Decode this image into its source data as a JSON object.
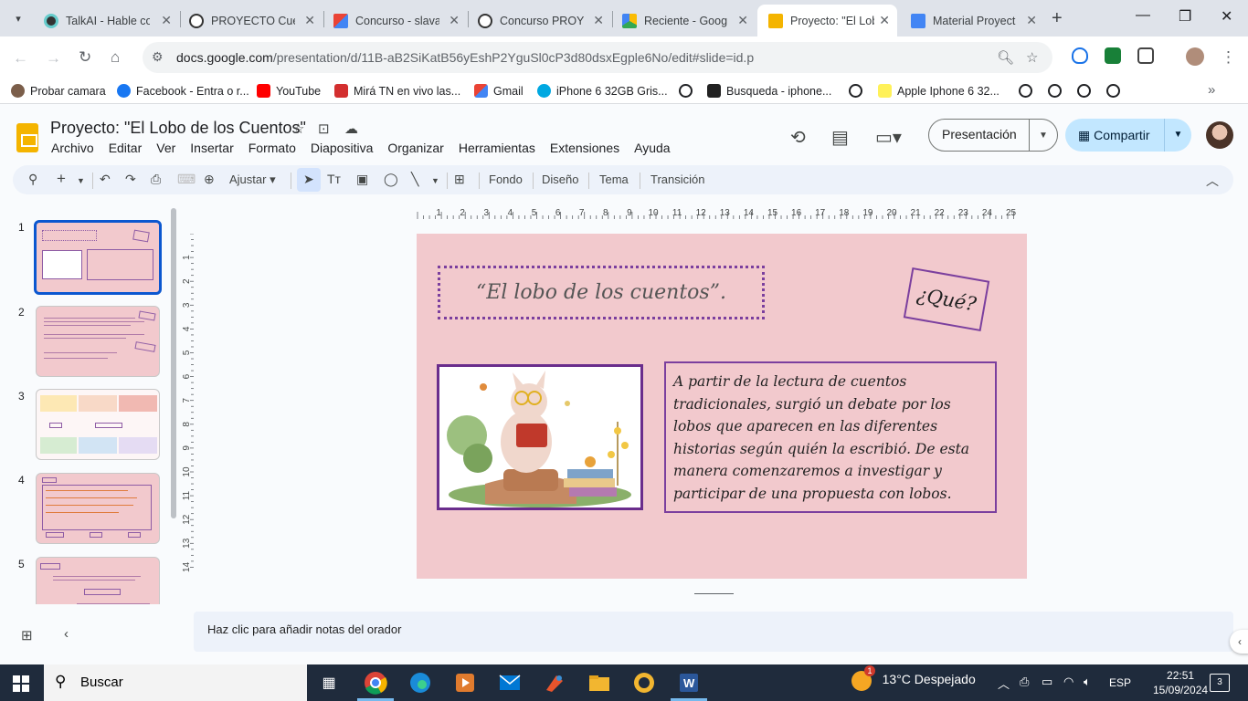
{
  "browser": {
    "tabs": [
      {
        "title": "TalkAI - Hable co",
        "favicon": "talkai-icon"
      },
      {
        "title": "PROYECTO Cuen",
        "favicon": "chatgpt-icon"
      },
      {
        "title": "Concurso - slava",
        "favicon": "gmail-icon"
      },
      {
        "title": "Concurso PROYE",
        "favicon": "chatgpt-icon"
      },
      {
        "title": "Reciente - Goog",
        "favicon": "drive-icon"
      },
      {
        "title": "Proyecto: \"El Lob",
        "favicon": "slides-icon"
      },
      {
        "title": "Material Proyect",
        "favicon": "docs-icon"
      }
    ],
    "url_host": "docs.google.com",
    "url_path": "/presentation/d/11B-aB2SiKatB56yEshP2YguSl0cP3d80dsxEgple6No/edit#slide=id.p",
    "bookmarks": [
      "Probar camara",
      "Facebook - Entra o r...",
      "YouTube",
      "Mirá TN en vivo las...",
      "Gmail",
      "iPhone 6 32GB Gris...",
      "Busqueda - iphone...",
      "Apple Iphone 6 32..."
    ]
  },
  "slides_app": {
    "doc_title": "Proyecto: \"El Lobo de los Cuentos\"",
    "menu": [
      "Archivo",
      "Editar",
      "Ver",
      "Insertar",
      "Formato",
      "Diapositiva",
      "Organizar",
      "Herramientas",
      "Extensiones",
      "Ayuda"
    ],
    "present_label": "Presentación",
    "share_label": "Compartir",
    "toolbar": {
      "zoom_label": "Ajustar",
      "background": "Fondo",
      "layout": "Diseño",
      "theme": "Tema",
      "transition": "Transición"
    },
    "thumbnails": [
      "1",
      "2",
      "3",
      "4",
      "5"
    ],
    "ruler_h": [
      "1",
      "2",
      "3",
      "4",
      "5",
      "6",
      "7",
      "8",
      "9",
      "10",
      "11",
      "12",
      "13",
      "14",
      "15",
      "16",
      "17",
      "18",
      "19",
      "20",
      "21",
      "22",
      "23",
      "24",
      "25"
    ],
    "ruler_v": [
      "1",
      "2",
      "3",
      "4",
      "5",
      "6",
      "7",
      "8",
      "9",
      "10",
      "11",
      "12",
      "13",
      "14"
    ],
    "slide": {
      "title": "“El lobo de los cuentos”.",
      "question": "¿Qué?",
      "body": "A partir de la lectura de cuentos tradicionales, surgió un debate por los lobos que aparecen en las diferentes historias según quién la escribió. De esta manera comenzaremos a investigar y participar de una propuesta con lobos.",
      "background_color": "#f2c9cd",
      "accent_color": "#7b3f9e"
    },
    "notes_placeholder": "Haz clic para añadir notas del orador"
  },
  "taskbar": {
    "search_placeholder": "Buscar",
    "weather": "13°C  Despejado",
    "weather_badge": "1",
    "language": "ESP",
    "time": "22:51",
    "date": "15/09/2024",
    "notifications": "3"
  }
}
